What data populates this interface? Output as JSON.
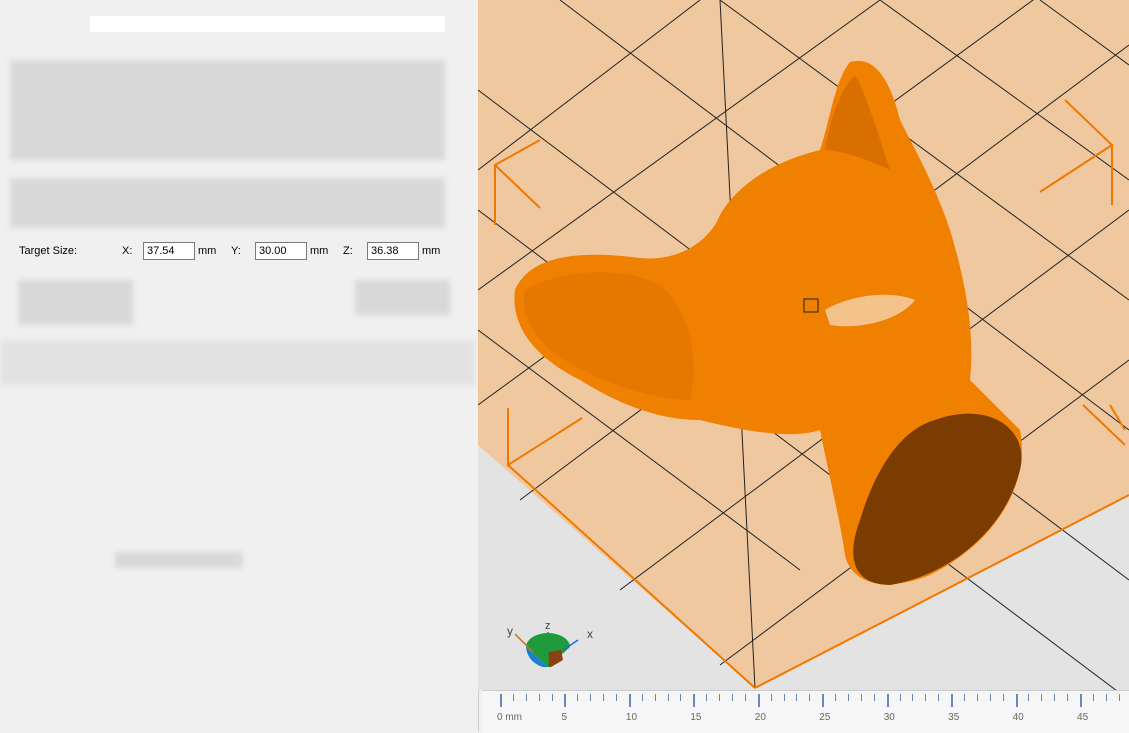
{
  "target_size": {
    "label": "Target Size:",
    "x_label": "X:",
    "x_value": "37.54",
    "y_label": "Y:",
    "y_value": "30.00",
    "z_label": "Z:",
    "z_value": "36.38",
    "unit": "mm"
  },
  "axis_gizmo": {
    "x": "x",
    "y": "y",
    "z": "z"
  },
  "ruler": {
    "unit": "mm",
    "labels": [
      "0 mm",
      "5",
      "10",
      "15",
      "20",
      "25",
      "30",
      "35",
      "40",
      "45"
    ]
  },
  "colors": {
    "plate": "#f0c8a0",
    "model": "#f08000",
    "model_shadow": "#7a3c00",
    "bbox": "#f07800"
  }
}
